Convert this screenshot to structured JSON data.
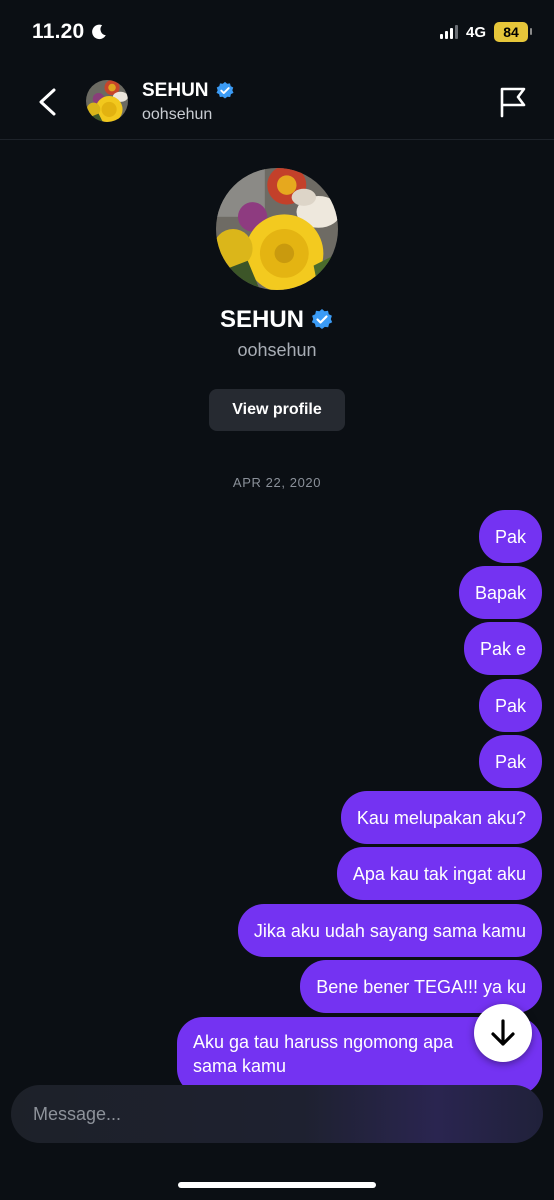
{
  "status_bar": {
    "time": "11.20",
    "network": "4G",
    "battery": "84"
  },
  "header": {
    "name": "SEHUN",
    "username": "oohsehun"
  },
  "profile": {
    "name": "SEHUN",
    "username": "oohsehun",
    "view_profile_label": "View profile"
  },
  "date_divider": "APR 22, 2020",
  "messages": [
    {
      "text": "Pak"
    },
    {
      "text": "Bapak"
    },
    {
      "text": "Pak e"
    },
    {
      "text": "Pak"
    },
    {
      "text": "Pak"
    },
    {
      "text": "Kau melupakan aku?"
    },
    {
      "text": "Apa kau tak ingat aku"
    },
    {
      "text": "Jika aku udah sayang sama kamu"
    },
    {
      "text": "Bene bener TEGA!!! ya ku"
    },
    {
      "text": "Aku ga tau haruss ngomong apa sama kamu"
    }
  ],
  "composer": {
    "placeholder": "Message..."
  },
  "colors": {
    "background": "#0b0f14",
    "bubble": "#7433f2",
    "verified": "#3b9bf5",
    "battery": "#e6c63a"
  },
  "icons": {
    "back": "chevron-left-icon",
    "flag": "flag-icon",
    "verified": "verified-badge-icon",
    "scroll": "arrow-down-icon",
    "moon": "moon-icon"
  }
}
